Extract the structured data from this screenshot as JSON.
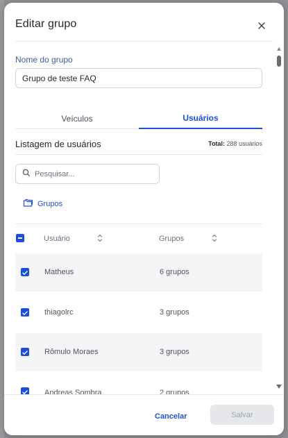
{
  "modal": {
    "title": "Editar grupo",
    "close_icon": "close-icon"
  },
  "form": {
    "group_name_label": "Nome do grupo",
    "group_name_value": "Grupo de teste FAQ"
  },
  "tabs": [
    {
      "label": "Veículos",
      "active": false
    },
    {
      "label": "Usuários",
      "active": true
    }
  ],
  "listing": {
    "title": "Listagem de usuários",
    "total_label": "Total:",
    "total_value": "288 usuários"
  },
  "search": {
    "placeholder": "Pesquisar...",
    "icon": "search-icon"
  },
  "groups_button": {
    "label": "Grupos",
    "icon": "folder-icon"
  },
  "table": {
    "columns": [
      "Usuário",
      "Grupos"
    ],
    "rows": [
      {
        "user": "Matheus",
        "groups": "6 grupos",
        "checked": true
      },
      {
        "user": "thiagolrc",
        "groups": "3 grupos",
        "checked": true
      },
      {
        "user": "Rômulo Moraes",
        "groups": "3 grupos",
        "checked": true
      },
      {
        "user": "Andreas Sombra",
        "groups": "2 grupos",
        "checked": true
      }
    ]
  },
  "footer": {
    "cancel_label": "Cancelar",
    "save_label": "Salvar"
  },
  "colors": {
    "accent": "#1d4ed8",
    "label": "#3f5f8f",
    "disabled_bg": "#e5e7eb",
    "disabled_text": "#9ca3af"
  }
}
